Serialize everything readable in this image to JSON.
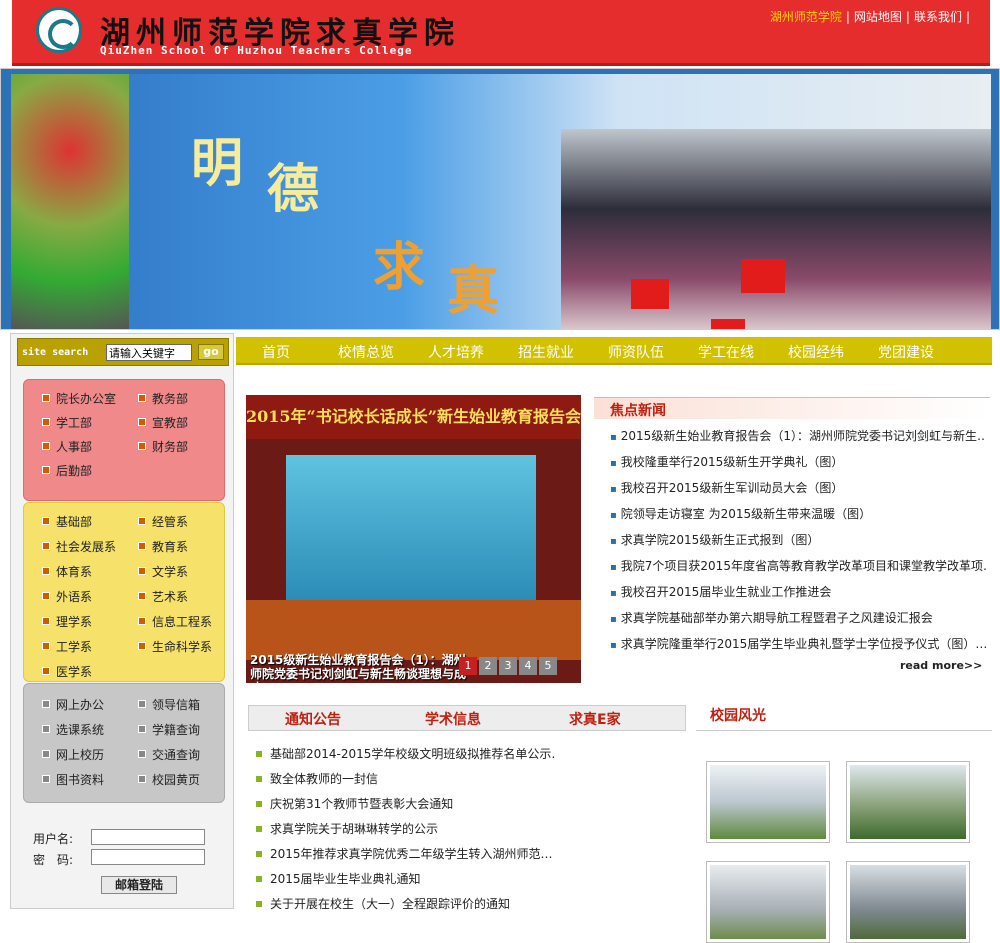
{
  "header": {
    "title": "湖州师范学院求真学院",
    "subtitle": "QiuZhen School Of Huzhou Teachers College",
    "links": [
      "湖州师范学院",
      "网站地图",
      "联系我们"
    ]
  },
  "banner": {
    "chars": [
      "明",
      "德",
      "求",
      "真"
    ]
  },
  "search": {
    "label": "site search",
    "placeholder": "请输入关键字",
    "button": "go"
  },
  "sidebar": {
    "admin": [
      "院长办公室",
      "教务部",
      "学工部",
      "宣教部",
      "人事部",
      "财务部",
      "后勤部"
    ],
    "depts": [
      "基础部",
      "经管系",
      "社会发展系",
      "教育系",
      "体育系",
      "文学系",
      "外语系",
      "艺术系",
      "理学系",
      "信息工程系",
      "工学系",
      "生命科学系",
      "医学系"
    ],
    "services": [
      "网上办公",
      "领导信箱",
      "选课系统",
      "学籍查询",
      "网上校历",
      "交通查询",
      "图书资料",
      "校园黄页"
    ]
  },
  "login": {
    "username_label": "用户名:",
    "password_label": "密　码:",
    "button": "邮箱登陆"
  },
  "nav": [
    "首页",
    "校情总览",
    "人才培养",
    "招生就业",
    "师资队伍",
    "学工在线",
    "校园经纬",
    "党团建设"
  ],
  "slide": {
    "banner_text": "2015年“书记校长话成长”新生始业教育报告会",
    "caption": "2015级新生始业教育报告会（1）：湖州师院党委书记刘剑虹与新生畅谈理想与成才",
    "numbers": [
      "1",
      "2",
      "3",
      "4",
      "5"
    ]
  },
  "focus": {
    "title": "焦点新闻",
    "items": [
      "2015级新生始业教育报告会（1）：湖州师院党委书记刘剑虹与新生…",
      "我校隆重举行2015级新生开学典礼（图）",
      "我校召开2015级新生军训动员大会（图）",
      "院领导走访寝室 为2015级新生带来温暖（图）",
      "求真学院2015级新生正式报到（图）",
      "我院7个项目获2015年度省高等教育教学改革项目和课堂教学改革项…",
      "我校召开2015届毕业生就业工作推进会",
      "求真学院基础部举办第六期导航工程暨君子之风建设汇报会",
      "求真学院隆重举行2015届学生毕业典礼暨学士学位授予仪式（图）…"
    ],
    "read_more": "read more>>"
  },
  "tabs": [
    "通知公告",
    "学术信息",
    "求真E家"
  ],
  "notices": [
    "基础部2014-2015学年校级文明班级拟推荐名单公示…",
    "致全体教师的一封信",
    "庆祝第31个教师节暨表彰大会通知",
    "求真学院关于胡琳琳转学的公示",
    "2015年推荐求真学院优秀二年级学生转入湖州师范…",
    "2015届毕业生毕业典礼通知",
    "关于开展在校生（大一）全程跟踪评价的通知"
  ],
  "campus": {
    "title": "校园风光"
  }
}
